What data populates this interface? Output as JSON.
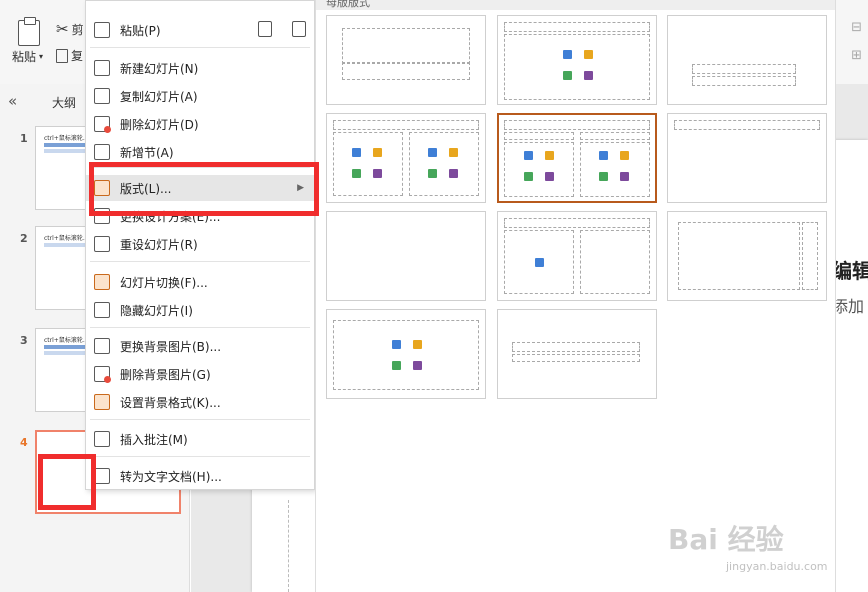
{
  "ribbon": {
    "paste_label": "粘贴",
    "cut_label": "剪",
    "copy_label": "复"
  },
  "panel": {
    "collapse_glyph": "«",
    "outline_tab": "大纲",
    "slides": [
      {
        "num": "1",
        "title": "ctrl+鼠标滚轮..."
      },
      {
        "num": "2",
        "title": "ctrl+鼠标滚轮..."
      },
      {
        "num": "3",
        "title": "ctrl+鼠标滚轮..."
      },
      {
        "num": "4",
        "title": ""
      }
    ]
  },
  "menu": {
    "paste": "粘贴(P)",
    "new_slide": "新建幻灯片(N)",
    "copy_slide": "复制幻灯片(A)",
    "delete_slide": "删除幻灯片(D)",
    "new_section": "新增节(A)",
    "layout": "版式(L)...",
    "change_design": "更换设计方案(E)...",
    "reset_slide": "重设幻灯片(R)",
    "transition": "幻灯片切换(F)...",
    "hide_slide": "隐藏幻灯片(I)",
    "change_bg": "更换背景图片(B)...",
    "delete_bg": "删除背景图片(G)",
    "bg_format": "设置背景格式(K)...",
    "insert_comment": "插入批注(M)",
    "to_doc": "转为文字文档(H)..."
  },
  "layout_pane": {
    "title": "母版版式"
  },
  "slide": {
    "title_partial": "编辑",
    "sub_partial": "添加"
  },
  "watermark": {
    "logo": "Bai  经验",
    "url": "jingyan.baidu.com"
  },
  "colors": {
    "highlight_red": "#f02d2d",
    "selected_layout": "#b85a1c",
    "selected_thumb": "#f0826a"
  }
}
